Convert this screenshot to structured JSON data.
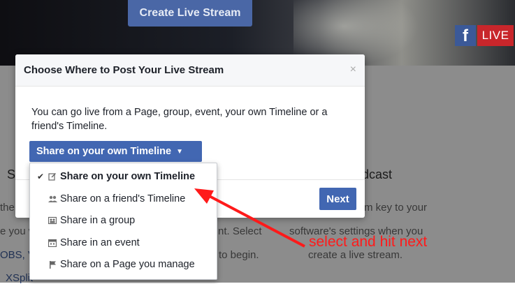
{
  "hero": {
    "create_button": "Create Live Stream",
    "fb_badge": "f",
    "live_badge": "LIVE"
  },
  "background": {
    "heading_left": "S",
    "heading_right": "dcast",
    "line1_left": "the",
    "line1_right": "m key to your",
    "line2_left": "e you w",
    "line2_mid": "nt. Select",
    "line2_right": "software's settings when you",
    "line3_left": "OBS, V",
    "line3_mid": "to begin.",
    "line3_right": "create a live stream.",
    "line4_left": "XSplit"
  },
  "modal": {
    "title": "Choose Where to Post Your Live Stream",
    "close": "×",
    "description": "You can go live from a Page, group, event, your own Timeline or a friend's Timeline.",
    "share_button": "Share on your own Timeline",
    "share_caret": "▼",
    "next_button": "Next"
  },
  "dropdown": {
    "items": [
      {
        "label": "Share on your own Timeline",
        "icon": "edit-icon",
        "selected": true
      },
      {
        "label": "Share on a friend's Timeline",
        "icon": "friends-icon",
        "selected": false
      },
      {
        "label": "Share in a group",
        "icon": "group-icon",
        "selected": false
      },
      {
        "label": "Share in an event",
        "icon": "calendar-icon",
        "selected": false
      },
      {
        "label": "Share on a Page you manage",
        "icon": "flag-icon",
        "selected": false
      }
    ],
    "checkmark": "✔"
  },
  "annotation": {
    "text": "select and hit next",
    "color": "#ff1a1a"
  },
  "colors": {
    "facebook_blue": "#4267b2",
    "live_red": "#c8262b"
  }
}
